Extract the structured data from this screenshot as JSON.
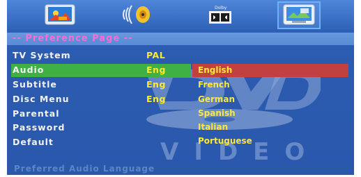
{
  "topbar": {
    "icons": [
      {
        "name": "general-setup-icon"
      },
      {
        "name": "audio-setup-icon"
      },
      {
        "name": "dolby-digital-icon",
        "label": "Dolby"
      },
      {
        "name": "preference-icon"
      }
    ]
  },
  "page": {
    "title": "-- Preference Page --"
  },
  "menu": {
    "items": [
      {
        "label": "TV System",
        "value": "PAL"
      },
      {
        "label": "Audio",
        "value": "Eng"
      },
      {
        "label": "Subtitle",
        "value": "Eng"
      },
      {
        "label": "Disc Menu",
        "value": "Eng"
      },
      {
        "label": "Parental",
        "value": ""
      },
      {
        "label": "Password",
        "value": ""
      },
      {
        "label": "Default",
        "value": ""
      }
    ],
    "selected_index": 1
  },
  "options": {
    "items": [
      "English",
      "French",
      "German",
      "Spanish",
      "Italian",
      "Portuguese"
    ],
    "selected_index": 0
  },
  "background": {
    "logo_text": "DVD",
    "video_text": "VIDEO"
  },
  "status": {
    "text": "Preferred Audio Language"
  },
  "colors": {
    "screen_bg": "#2b5bb0",
    "selected_row": "#3fb045",
    "option_highlight": "#c2403f",
    "value_text": "#ffea2a",
    "title_text": "#ff6ad5"
  }
}
